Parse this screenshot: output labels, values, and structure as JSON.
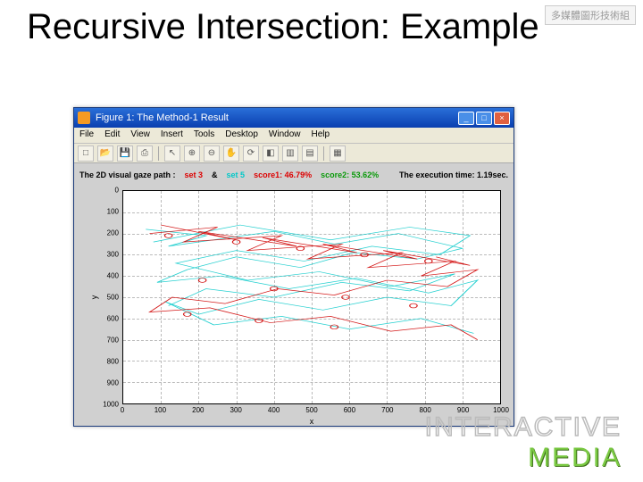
{
  "slide": {
    "title": "Recursive Intersection: Example",
    "corner_badge": "多媒體圖形技術組"
  },
  "window": {
    "title": "Figure 1: The Method-1 Result",
    "menus": {
      "file": "File",
      "edit": "Edit",
      "view": "View",
      "insert": "Insert",
      "tools": "Tools",
      "desktop": "Desktop",
      "window": "Window",
      "help": "Help"
    },
    "toolbar_icons": [
      "new",
      "open",
      "save",
      "print",
      "pointer",
      "zoomin",
      "zoomout",
      "pan",
      "rotate",
      "datatip",
      "colorbar",
      "legend",
      "sep",
      "axes"
    ],
    "buttons": {
      "min": "_",
      "max": "□",
      "close": "×"
    }
  },
  "plot": {
    "heading_black": "The 2D visual gaze path :",
    "set3_label": "set 3",
    "amp": "&",
    "set5_label": "set 5",
    "score1": "score1: 46.79%",
    "score2": "score2: 53.62%",
    "exec_time": "The execution time: 1.19sec.",
    "xlabel": "x",
    "ylabel": "y",
    "x_ticks": [
      0,
      100,
      200,
      300,
      400,
      500,
      600,
      700,
      800,
      900,
      1000
    ],
    "y_ticks": [
      0,
      100,
      200,
      300,
      400,
      500,
      600,
      700,
      800,
      900,
      1000
    ]
  },
  "chart_data": {
    "type": "line",
    "title": "The 2D visual gaze path",
    "xlabel": "x",
    "ylabel": "y",
    "xlim": [
      0,
      1000
    ],
    "ylim": [
      0,
      1000
    ],
    "y_reversed": true,
    "series": [
      {
        "name": "set 3",
        "color": "#d00000",
        "note": "gaze path scribble (red)",
        "score": 46.79
      },
      {
        "name": "set 5",
        "color": "#00c8c8",
        "note": "gaze path scribble (cyan)",
        "score": 53.62
      }
    ],
    "annotations": {
      "execution_time_sec": 1.19
    }
  },
  "watermark": {
    "line1": "INTERACTIVE",
    "line2": "MEDIA"
  }
}
